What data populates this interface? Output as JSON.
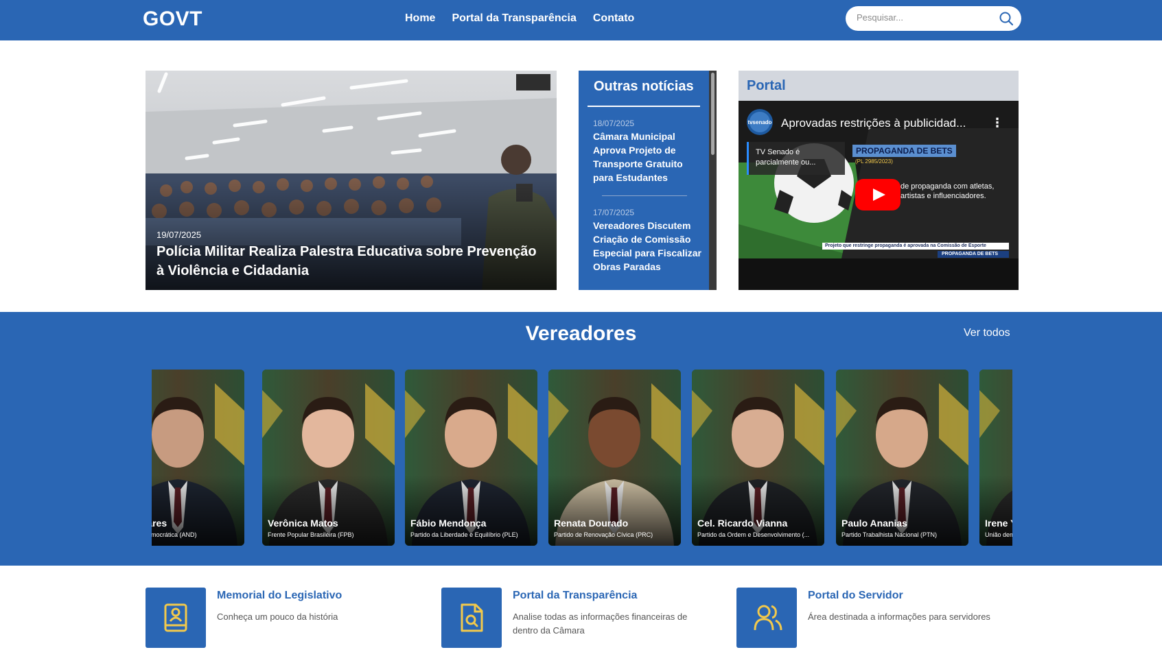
{
  "header": {
    "logo": "GOVT",
    "nav": [
      "Home",
      "Portal da Transparência",
      "Contato"
    ],
    "search_placeholder": "Pesquisar..."
  },
  "hero": {
    "date": "19/07/2025",
    "title": "Polícia Militar Realiza Palestra Educativa sobre Prevenção à Violência e Cidadania"
  },
  "outras": {
    "title": "Outras notícias",
    "items": [
      {
        "date": "18/07/2025",
        "title": "Câmara Municipal Aprova Projeto de Transporte Gratuito para Estudantes"
      },
      {
        "date": "17/07/2025",
        "title": "Vereadores Discutem Criação de Comissão Especial para Fiscalizar Obras Paradas"
      }
    ]
  },
  "portal": {
    "title": "Portal",
    "video": {
      "channel_logo": "tvsenado",
      "title": "Aprovadas restrições à publicidad...",
      "card_text": "TV Senado é parcialmente ou...",
      "tag": "PROPAGANDA DE BETS",
      "tag_sub": "(PL 2985/2023)",
      "desc": "de propaganda com atletas, artistas e influenciadores.",
      "strip1": "Projeto que restringe propaganda é aprovada na Comissão de Esporte",
      "strip2": "PROPAGANDA DE BETS"
    }
  },
  "vereadores": {
    "title": "Vereadores",
    "see_all": "Ver todos",
    "members": [
      {
        "name": "os Tavares",
        "party": "Nacional Democrática (AND)"
      },
      {
        "name": "Verônica Matos",
        "party": "Frente Popular Brasileira (FPB)"
      },
      {
        "name": "Fábio Mendonça",
        "party": "Partido da Liberdade e Equilíbrio (PLE)"
      },
      {
        "name": "Renata Dourado",
        "party": "Partido de Renovação Cívica (PRC)"
      },
      {
        "name": "Cel. Ricardo Vianna",
        "party": "Partido da Ordem e Desenvolvimento (..."
      },
      {
        "name": "Paulo Ananias",
        "party": "Partido Trabalhista Nacional (PTN)"
      },
      {
        "name": "Irene Y",
        "party": "União dem"
      }
    ]
  },
  "features": [
    {
      "title": "Memorial do Legislativo",
      "desc": "Conheça um pouco da história",
      "icon": "book-user-icon"
    },
    {
      "title": "Portal da Transparência",
      "desc": "Analise todas as informações financeiras de dentro da Câmara",
      "icon": "file-search-icon"
    },
    {
      "title": "Portal do Servidor",
      "desc": "Área destinada a informações para servidores",
      "icon": "users-icon"
    }
  ],
  "colors": {
    "primary": "#2a66b4",
    "accent": "#f2c94c"
  }
}
